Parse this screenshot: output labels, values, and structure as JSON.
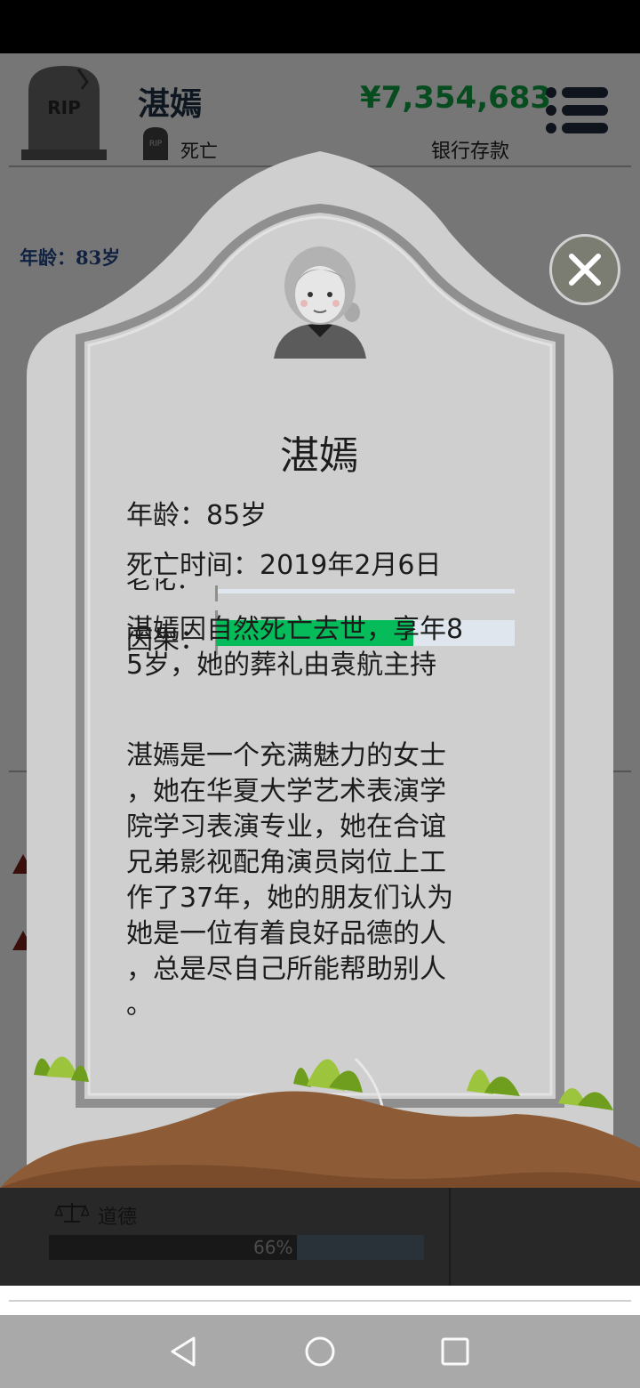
{
  "header": {
    "name": "湛嫣",
    "status": "死亡",
    "money": "¥7,354,683",
    "money_caption": "银行存款",
    "avatar_text": "RIP",
    "small_icon_text": "RIP"
  },
  "background": {
    "age_line": "年龄：83岁",
    "moral": {
      "label": "道德",
      "percent_text": "66%",
      "value": 0.66
    }
  },
  "epitaph": {
    "name": "湛嫣",
    "age_line": "年龄：85岁",
    "death_time_line": "死亡时间：2019年2月6日",
    "partial_label": "老化：",
    "karma_label": "因果：",
    "karma_value": 0.66,
    "cause_lines": [
      "湛嫣因自然死亡去世，享年8",
      "5岁，她的葬礼由袁航主持"
    ],
    "bio_lines": [
      "湛嫣是一个充满魅力的女士",
      "，她在华夏大学艺术表演学",
      "院学习表演专业，她在合谊",
      "兄弟影视配角演员岗位上工",
      "作了37年，她的朋友们认为",
      "她是一位有着良好品德的人",
      "，总是尽自己所能帮助别人",
      "。"
    ]
  },
  "colors": {
    "money": "#0b8a3a",
    "karma_fill": "#05bb5a",
    "stone": "#cfcfcf",
    "dirt": "#8d5c36",
    "grass": "#8ab82a"
  },
  "icons": [
    "rip-gravestone-icon",
    "menu-icon",
    "close-icon",
    "balance-scale-icon",
    "back-nav-icon",
    "home-nav-icon",
    "recents-nav-icon",
    "grandma-avatar-icon"
  ]
}
